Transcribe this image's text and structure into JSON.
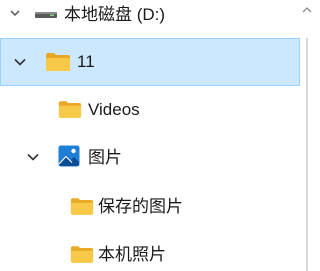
{
  "tree": {
    "items": [
      {
        "label": "本地磁盘 (D:)",
        "icon": "drive-icon",
        "expanded": null,
        "selected": false
      },
      {
        "label": "11",
        "icon": "folder-icon",
        "expanded": true,
        "selected": true
      },
      {
        "label": "Videos",
        "icon": "folder-icon",
        "expanded": null,
        "selected": false
      },
      {
        "label": "图片",
        "icon": "pictures-icon",
        "expanded": true,
        "selected": false
      },
      {
        "label": "保存的图片",
        "icon": "folder-icon",
        "expanded": null,
        "selected": false
      },
      {
        "label": "本机照片",
        "icon": "folder-icon",
        "expanded": null,
        "selected": false
      }
    ]
  },
  "colors": {
    "selection_bg": "#cce8ff",
    "selection_border": "#99d1ff",
    "folder": "#f8c948",
    "pictures": "#1f7fd6"
  }
}
